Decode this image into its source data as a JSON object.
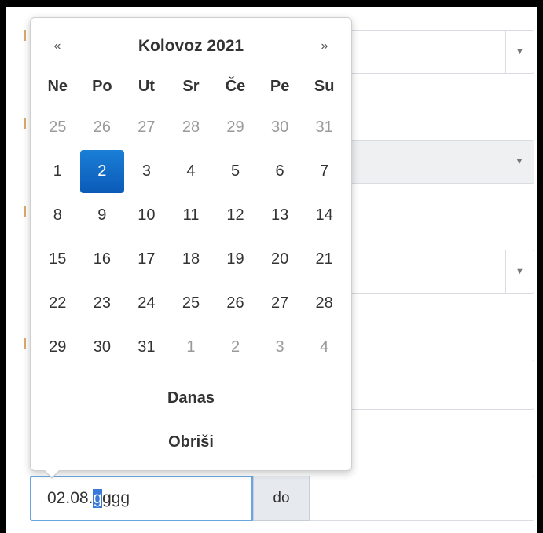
{
  "datepicker": {
    "prev": "«",
    "next": "»",
    "month_year": "Kolovoz 2021",
    "weekdays": [
      "Ne",
      "Po",
      "Ut",
      "Sr",
      "Če",
      "Pe",
      "Su"
    ],
    "weeks": [
      [
        "25",
        "26",
        "27",
        "28",
        "29",
        "30",
        "31"
      ],
      [
        "1",
        "2",
        "3",
        "4",
        "5",
        "6",
        "7"
      ],
      [
        "8",
        "9",
        "10",
        "11",
        "12",
        "13",
        "14"
      ],
      [
        "15",
        "16",
        "17",
        "18",
        "19",
        "20",
        "21"
      ],
      [
        "22",
        "23",
        "24",
        "25",
        "26",
        "27",
        "28"
      ],
      [
        "29",
        "30",
        "31",
        "1",
        "2",
        "3",
        "4"
      ]
    ],
    "selected_day": "2",
    "today_button": "Danas",
    "clear_button": "Obriši"
  },
  "date_range": {
    "from_value_prefix": "02.08.",
    "from_value_selected": "g",
    "from_value_suffix": "ggg",
    "separator": "do",
    "to_value": ""
  },
  "colors": {
    "selected_day_bg": "#0b5ab8",
    "focus_border": "#6aa6e0",
    "addon_bg": "#e6e9ee"
  }
}
